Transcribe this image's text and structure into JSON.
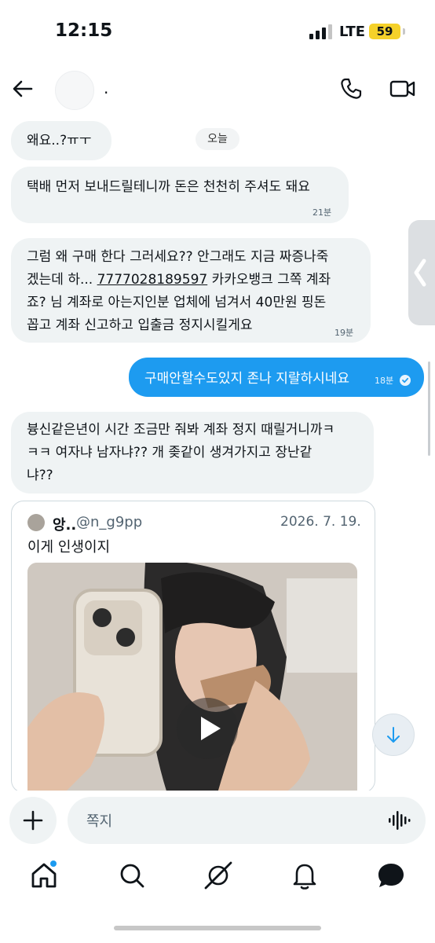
{
  "status_bar": {
    "time": "12:15",
    "network": "LTE",
    "battery": "59"
  },
  "header": {
    "contact_name": "."
  },
  "day_label": "오늘",
  "messages": [
    {
      "type": "received",
      "text": "왜요..?ㅠㅜ"
    },
    {
      "type": "received",
      "text": "택배 먼저 보내드릴테니까 돈은 천천히 주셔도 돼요",
      "time": "21분"
    },
    {
      "type": "received",
      "lines": [
        "그럼 왜 구매 한다 그러세요?? 안그래도 지금 짜증나죽",
        "겠는데 하... 7777028189597 카카오뱅크 그쪽 계좌",
        "죠? 님 계좌로 아는지인분 업체에 넘겨서 40만원 핑돈",
        "꼽고 계좌 신고하고 입출금 정지시킬게요"
      ],
      "line2_prefix": "겠는데 하... ",
      "account_number": "7777028189597",
      "line2_suffix": " 카카오뱅크 그쪽 계좌",
      "time": "19분"
    },
    {
      "type": "sent",
      "text": "구매안할수도있지 존나 지랄하시네요",
      "time": "18분"
    },
    {
      "type": "received",
      "lines": [
        "븅신같은년이 시간 조금만 줘봐 계좌 정지 때릴거니까ㅋ",
        "ㅋㅋ 여자냐 남자냐?? 개 좆같이 생겨가지고 장난같",
        "냐??"
      ]
    }
  ],
  "quoted_post": {
    "author_name": "앙..",
    "handle": "@n_g9pp",
    "date": "2026. 7. 19.",
    "text": "이게 인생이지"
  },
  "composer": {
    "placeholder": "쪽지"
  },
  "colors": {
    "accent": "#1d9bf0",
    "bubble": "#eff3f4",
    "text": "#0f1419",
    "muted": "#536471",
    "battery": "#f5d12a"
  },
  "tabs": [
    "home-icon",
    "search-icon",
    "grok-icon",
    "notifications-icon",
    "messages-icon"
  ]
}
